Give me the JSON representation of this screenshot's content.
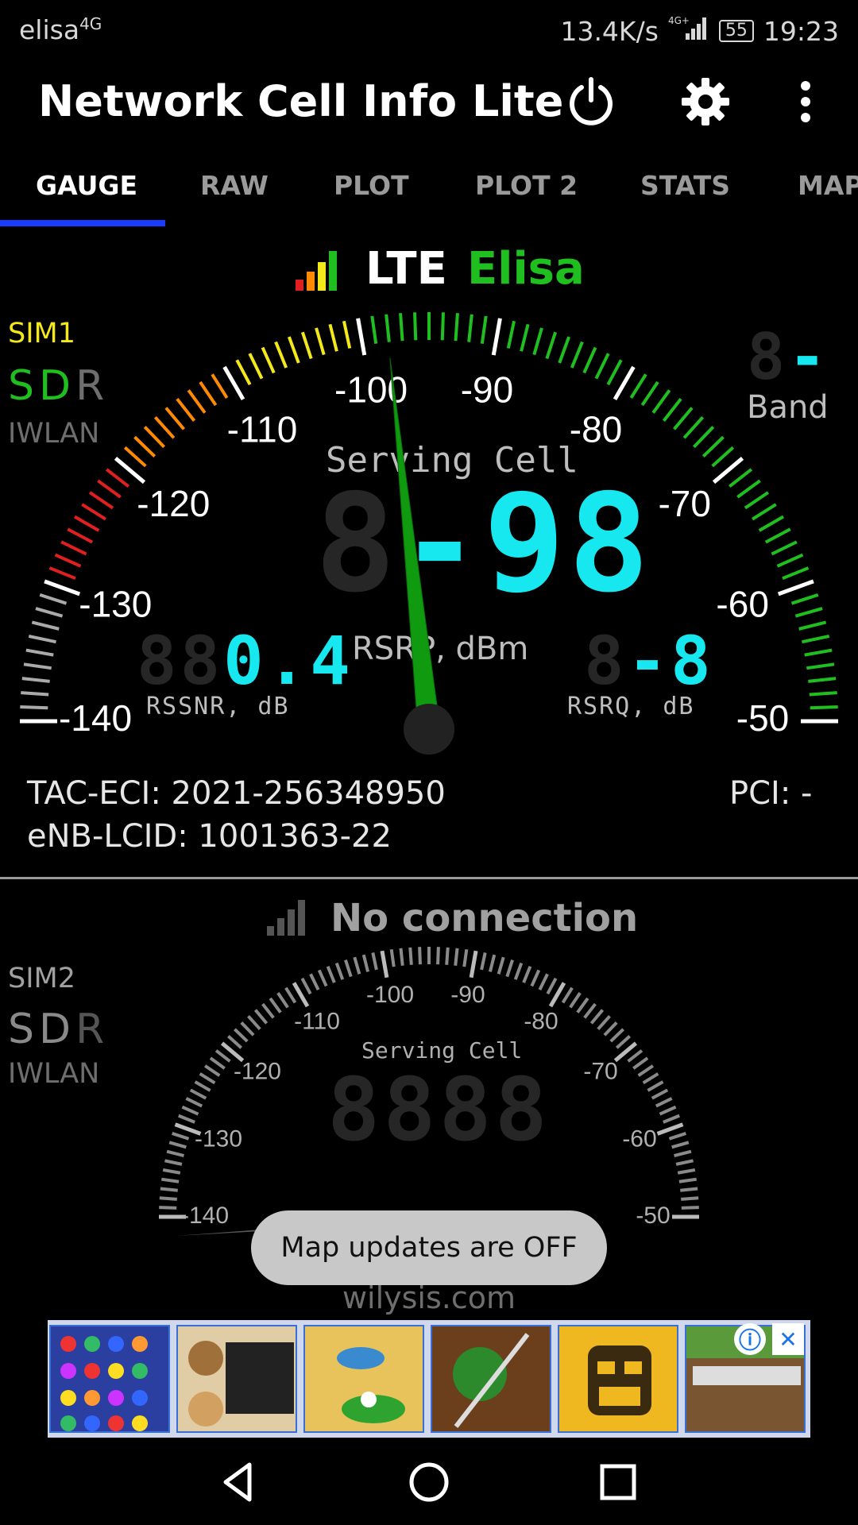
{
  "status_bar": {
    "carrier": "elisa",
    "carrier_network": "4G",
    "speed": "13.4K/s",
    "signal_network": "4G+",
    "battery": "55",
    "time": "19:23"
  },
  "app": {
    "title": "Network Cell Info Lite"
  },
  "tabs": [
    "GAUGE",
    "RAW",
    "PLOT",
    "PLOT 2",
    "STATS",
    "MAP"
  ],
  "active_tab": "GAUGE",
  "sim1": {
    "label": "SIM1",
    "sdr": [
      "S",
      "D",
      "R"
    ],
    "iwlan": "IWLAN",
    "network_type": "LTE",
    "operator": "Elisa",
    "band_value": "-",
    "band_label": "Band",
    "serving_cell": "Serving Cell",
    "rsrp_value": "-98",
    "rsrp_unit": "RSRP, dBm",
    "rssnr_value": "0.4",
    "rssnr_label": "RSSNR, dB",
    "rsrq_value": "-8",
    "rsrq_label": "RSRQ, dB",
    "gauge_labels": [
      "-140",
      "-130",
      "-120",
      "-110",
      "-100",
      "-90",
      "-80",
      "-70",
      "-60",
      "-50"
    ],
    "needle_value": -98,
    "tac_eci_label": "TAC-ECI:",
    "tac_eci": "2021-256348950",
    "enb_lcid_label": "eNB-LCID:",
    "enb_lcid": "1001363-22",
    "pci_label": "PCI:",
    "pci": "-"
  },
  "sim2": {
    "label": "SIM2",
    "sdr": [
      "S",
      "D",
      "R"
    ],
    "iwlan": "IWLAN",
    "status": "No connection",
    "serving_cell": "Serving Cell",
    "gauge_labels": [
      "-140",
      "-130",
      "-120",
      "-110",
      "-100",
      "-90",
      "-80",
      "-70",
      "-60",
      "-50"
    ]
  },
  "toast": "Map updates are OFF",
  "watermark": "wilysis.com",
  "ads": [
    "candy-crush",
    "grand-theft-auto",
    "wheres-my-water",
    "fruit-ninja",
    "temple-run",
    "minecraft"
  ],
  "colors": {
    "accent_blue": "#1a3cff",
    "green": "#1fbf1f",
    "cyan": "#17e8f0",
    "yellow": "#f2e81a"
  }
}
